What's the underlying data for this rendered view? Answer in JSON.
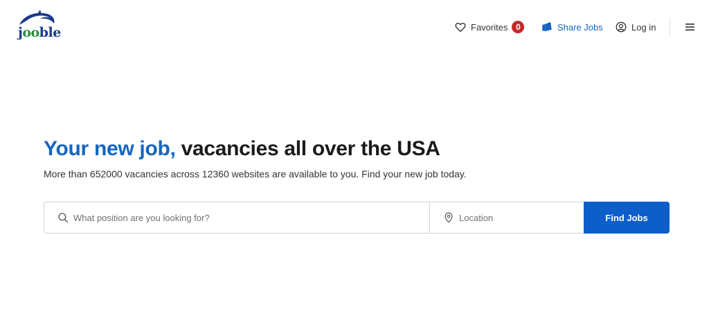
{
  "header": {
    "logo_text_pre": "j",
    "logo_text_oo": "oo",
    "logo_text_post": "ble",
    "favorites_label": "Favorites",
    "favorites_count": "0",
    "share_label": "Share Jobs",
    "login_label": "Log in"
  },
  "hero": {
    "title_accent": "Your new job,",
    "title_rest": " vacancies all over the USA",
    "subtitle": "More than 652000 vacancies across 12360 websites are available to you. Find your new job today."
  },
  "search": {
    "position_placeholder": "What position are you looking for?",
    "location_placeholder": "Location",
    "button_label": "Find Jobs"
  },
  "colors": {
    "brand_blue": "#1565c0",
    "button_blue": "#0d5ec9",
    "badge_red": "#c62828"
  },
  "icons": [
    "heart-icon",
    "share-icon",
    "user-icon",
    "menu-icon",
    "search-icon",
    "location-pin-icon"
  ]
}
